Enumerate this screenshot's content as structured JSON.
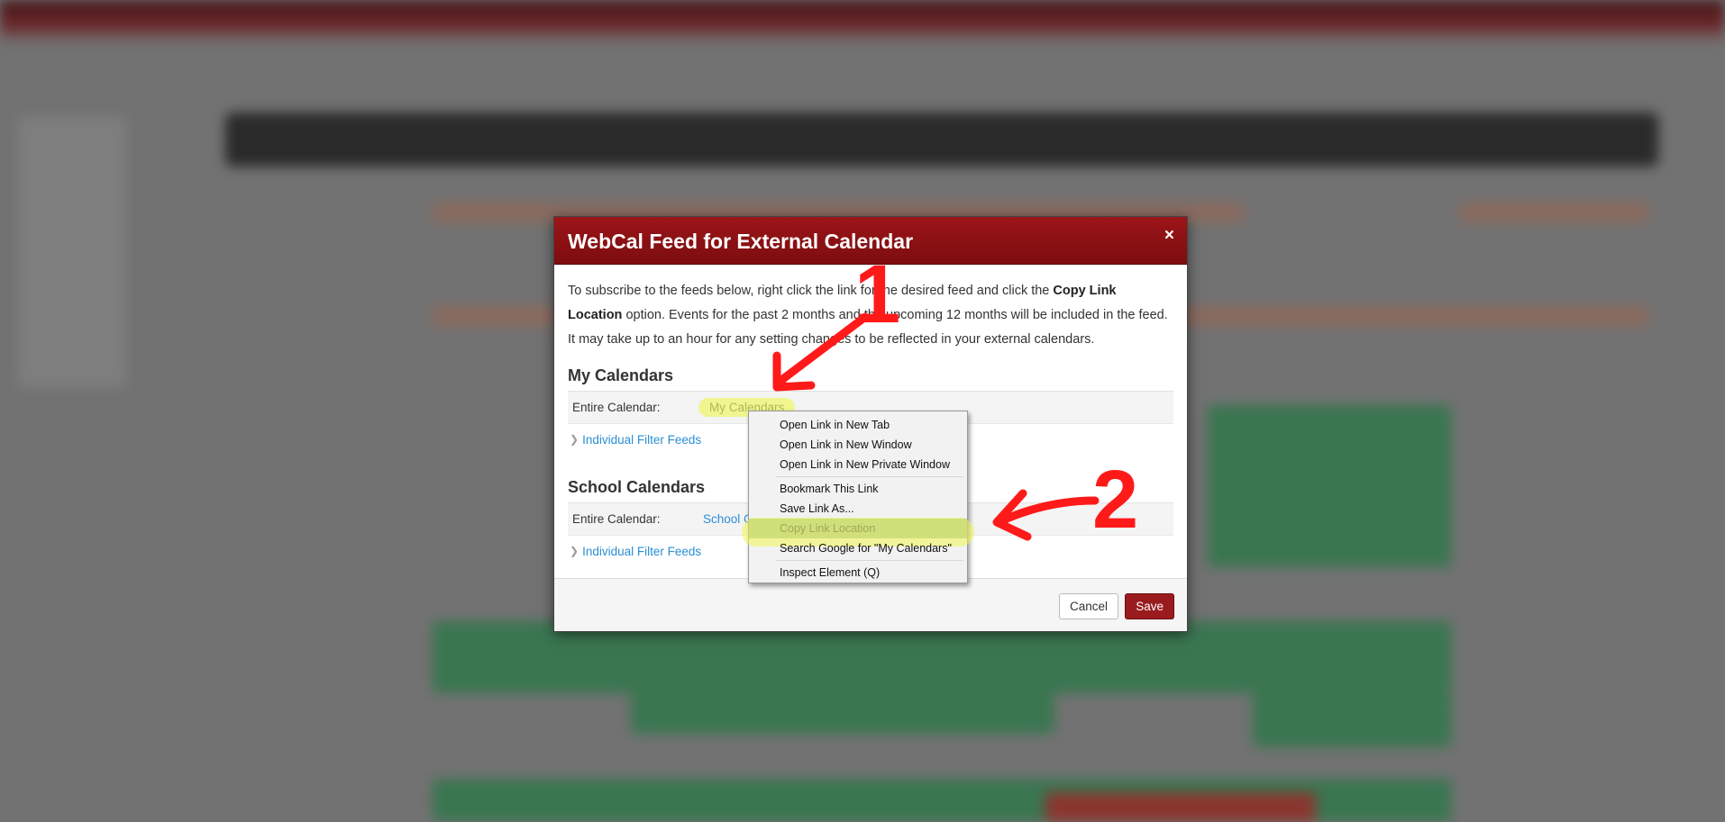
{
  "modal": {
    "title": "WebCal Feed for External Calendar",
    "close_label": "×",
    "intro_before": "To subscribe to the feeds below, right click the link for the desired feed and click the ",
    "intro_bold": "Copy Link Location",
    "intro_after": " option. Events for the past 2 months and the upcoming 12 months will be included in the feed. It may take up to an hour for any setting changes to be reflected in your external calendars.",
    "sections": [
      {
        "title": "My Calendars",
        "row_label": "Entire Calendar:",
        "link_text": "My Calendars",
        "filter_label": "Individual Filter Feeds"
      },
      {
        "title": "School Calendars",
        "row_label": "Entire Calendar:",
        "link_text": "School Calendars",
        "filter_label": "Individual Filter Feeds"
      }
    ],
    "cancel_label": "Cancel",
    "save_label": "Save"
  },
  "context_menu": {
    "items": [
      "Open Link in New Tab",
      "Open Link in New Window",
      "Open Link in New Private Window",
      "Bookmark This Link",
      "Save Link As...",
      "Copy Link Location",
      "Search Google for \"My Calendars\"",
      "Inspect Element (Q)"
    ]
  },
  "annotations": {
    "step1": "1",
    "step2": "2"
  },
  "colors": {
    "header_red": "#8f1215",
    "link_blue": "#2a8fd4",
    "annotation_red": "#ff1a1a",
    "highlight_yellow": "#eef55a"
  }
}
